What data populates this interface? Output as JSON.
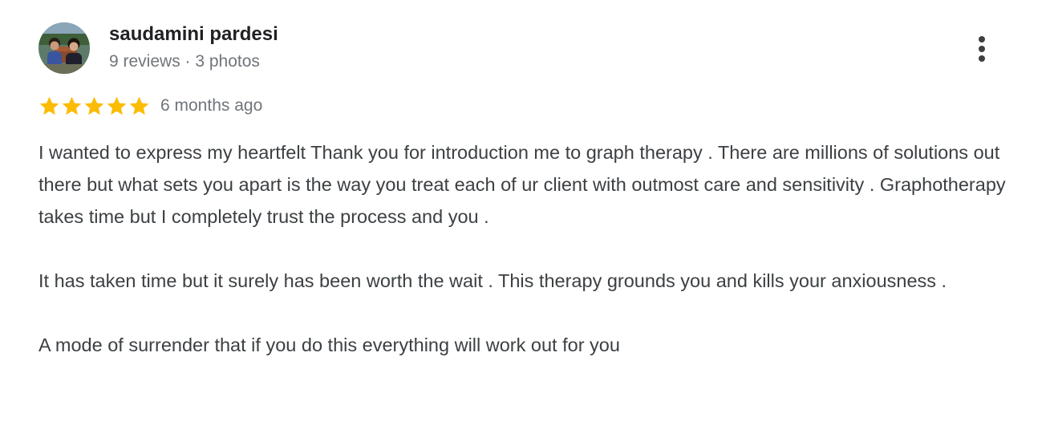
{
  "review": {
    "author": {
      "name": "saudamini pardesi",
      "meta": "9 reviews · 3 photos",
      "avatar_icon": "profile-photo"
    },
    "menu_icon": "more-vert-icon",
    "rating": 5,
    "max_rating": 5,
    "star_color": "#fbbc04",
    "date": "6 months ago",
    "paragraphs": [
      "I wanted to express my heartfelt Thank you for introduction me to graph therapy . There are millions of solutions out there but what sets you apart is the way you treat each of ur client with outmost care and sensitivity . Graphotherapy takes time but I completely trust the process and you .",
      "It has taken time but it surely has been worth the wait . This therapy grounds you and kills your anxiousness .",
      "A mode of surrender that if you do this everything will work out for you"
    ]
  }
}
